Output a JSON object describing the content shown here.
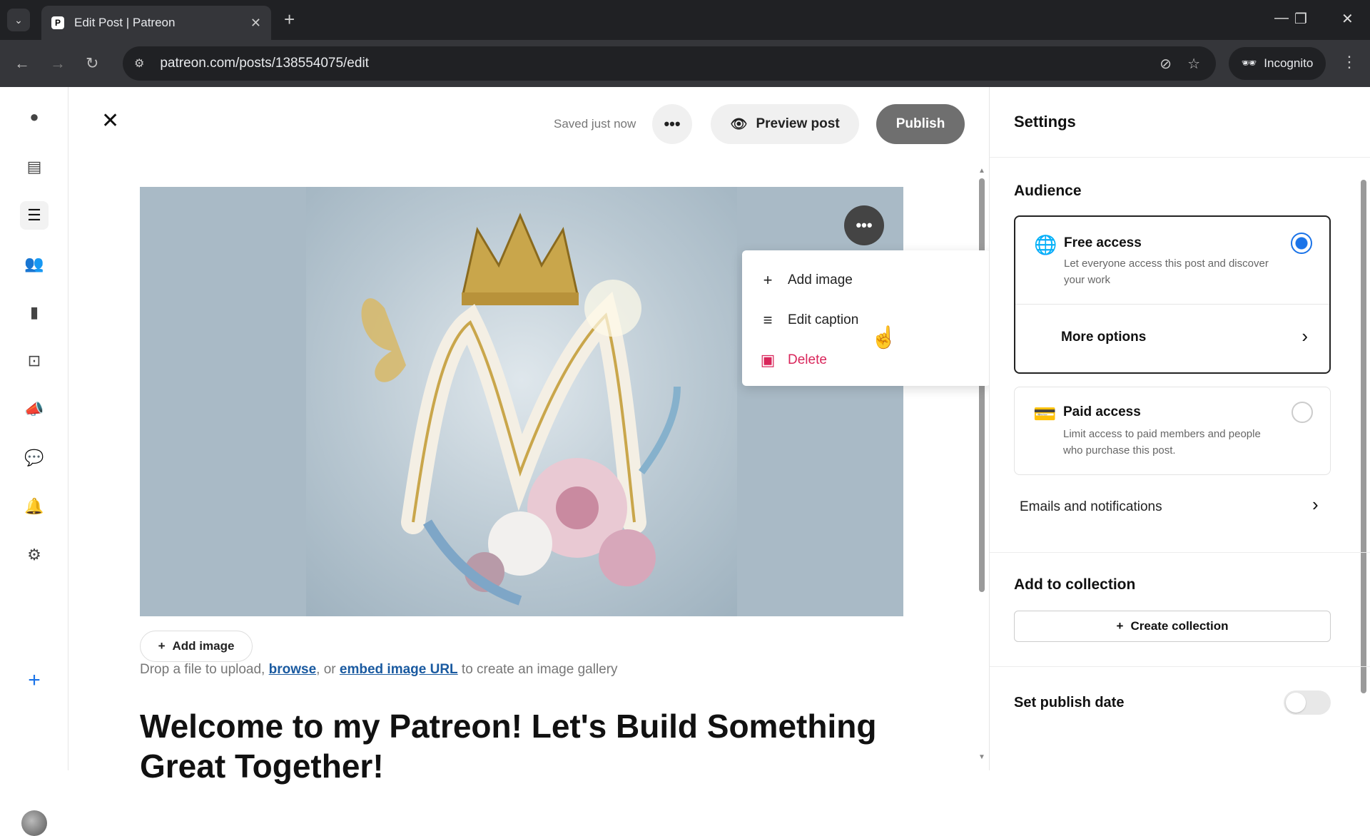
{
  "browser": {
    "tab_title": "Edit Post | Patreon",
    "url": "patreon.com/posts/138554075/edit",
    "incognito_label": "Incognito"
  },
  "editor": {
    "saved_status": "Saved just now",
    "preview_label": "Preview post",
    "publish_label": "Publish",
    "context_menu": {
      "items": [
        {
          "label": "Add image",
          "icon": "plus-icon"
        },
        {
          "label": "Edit caption",
          "icon": "lines-icon"
        },
        {
          "label": "Delete",
          "icon": "image-delete-icon"
        }
      ]
    },
    "add_image_label": "Add image",
    "drop_text_1": "Drop a file to upload, ",
    "drop_link_browse": "browse",
    "drop_text_2": ", or ",
    "drop_link_embed": "embed image URL",
    "drop_text_3": " to create an image gallery",
    "headline": "Welcome to my Patreon! Let's Build Something Great Together!"
  },
  "settings": {
    "title": "Settings",
    "audience_title": "Audience",
    "free_title": "Free access",
    "free_desc": "Let everyone access this post and discover your work",
    "more_options": "More options",
    "paid_title": "Paid access",
    "paid_desc": "Limit access to paid members and people who purchase this post.",
    "emails_label": "Emails and notifications",
    "collection_title": "Add to collection",
    "create_collection": "Create collection",
    "publish_date_label": "Set publish date"
  },
  "colors": {
    "accent_radio": "#1a73e8",
    "delete_red": "#d9265b",
    "publish_bg": "#6f6f6f"
  }
}
